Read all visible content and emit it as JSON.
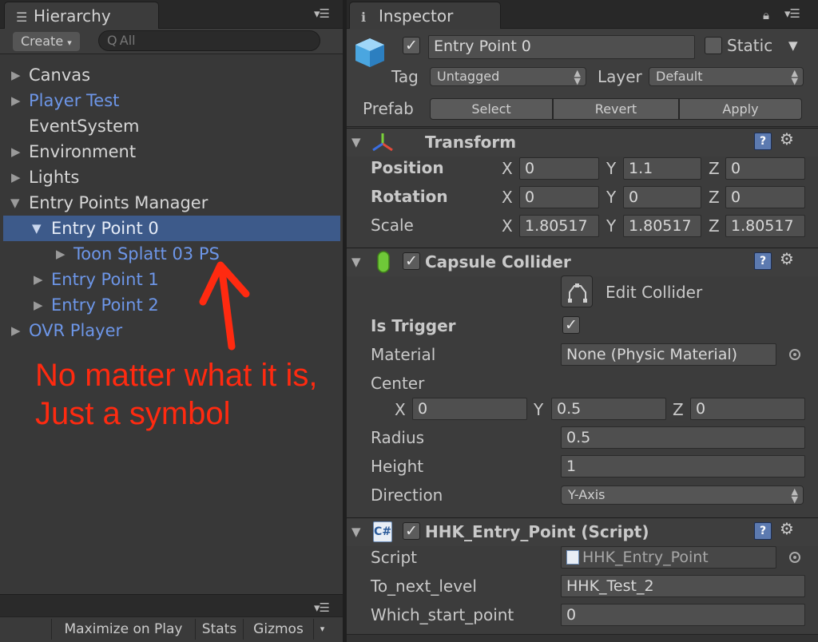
{
  "hierarchy": {
    "tab_title": "Hierarchy",
    "create_label": "Create",
    "search_placeholder": "Q All",
    "items": [
      {
        "label": "Canvas"
      },
      {
        "label": "Player Test"
      },
      {
        "label": "EventSystem"
      },
      {
        "label": "Environment"
      },
      {
        "label": "Lights"
      },
      {
        "label": "Entry Points Manager"
      },
      {
        "label": "Entry Point 0"
      },
      {
        "label": "Toon Splatt 03 PS"
      },
      {
        "label": "Entry Point 1"
      },
      {
        "label": "Entry Point 2"
      },
      {
        "label": "OVR Player"
      }
    ]
  },
  "annotation": {
    "line1": "No matter what it is,",
    "line2": "Just a symbol",
    "color": "#ff2a10"
  },
  "game_view": {
    "maximize_on_play": "Maximize on Play",
    "stats": "Stats",
    "gizmos": "Gizmos"
  },
  "inspector": {
    "tab_title": "Inspector",
    "object_name": "Entry Point 0",
    "static_label": "Static",
    "tag_label": "Tag",
    "tag_value": "Untagged",
    "layer_label": "Layer",
    "layer_value": "Default",
    "prefab_label": "Prefab",
    "prefab_select": "Select",
    "prefab_revert": "Revert",
    "prefab_apply": "Apply",
    "transform": {
      "title": "Transform",
      "position_label": "Position",
      "rotation_label": "Rotation",
      "scale_label": "Scale",
      "axis_x": "X",
      "axis_y": "Y",
      "axis_z": "Z",
      "position": {
        "x": "0",
        "y": "1.1",
        "z": "0"
      },
      "rotation": {
        "x": "0",
        "y": "0",
        "z": "0"
      },
      "scale": {
        "x": "1.80517",
        "y": "1.80517",
        "z": "1.80517"
      }
    },
    "capsule": {
      "title": "Capsule Collider",
      "edit_collider": "Edit Collider",
      "is_trigger_label": "Is Trigger",
      "material_label": "Material",
      "material_value": "None (Physic Material)",
      "center_label": "Center",
      "center": {
        "x": "0",
        "y": "0.5",
        "z": "0"
      },
      "radius_label": "Radius",
      "radius_value": "0.5",
      "height_label": "Height",
      "height_value": "1",
      "direction_label": "Direction",
      "direction_value": "Y-Axis"
    },
    "script_comp": {
      "title": "HHK_Entry_Point (Script)",
      "script_label": "Script",
      "script_value": "HHK_Entry_Point",
      "to_next_level_label": "To_next_level",
      "to_next_level_value": "HHK_Test_2",
      "which_start_point_label": "Which_start_point",
      "which_start_point_value": "0"
    }
  },
  "colors": {
    "selection": "#3d5a8a",
    "prefab_blue_text": "#6d96e8"
  }
}
